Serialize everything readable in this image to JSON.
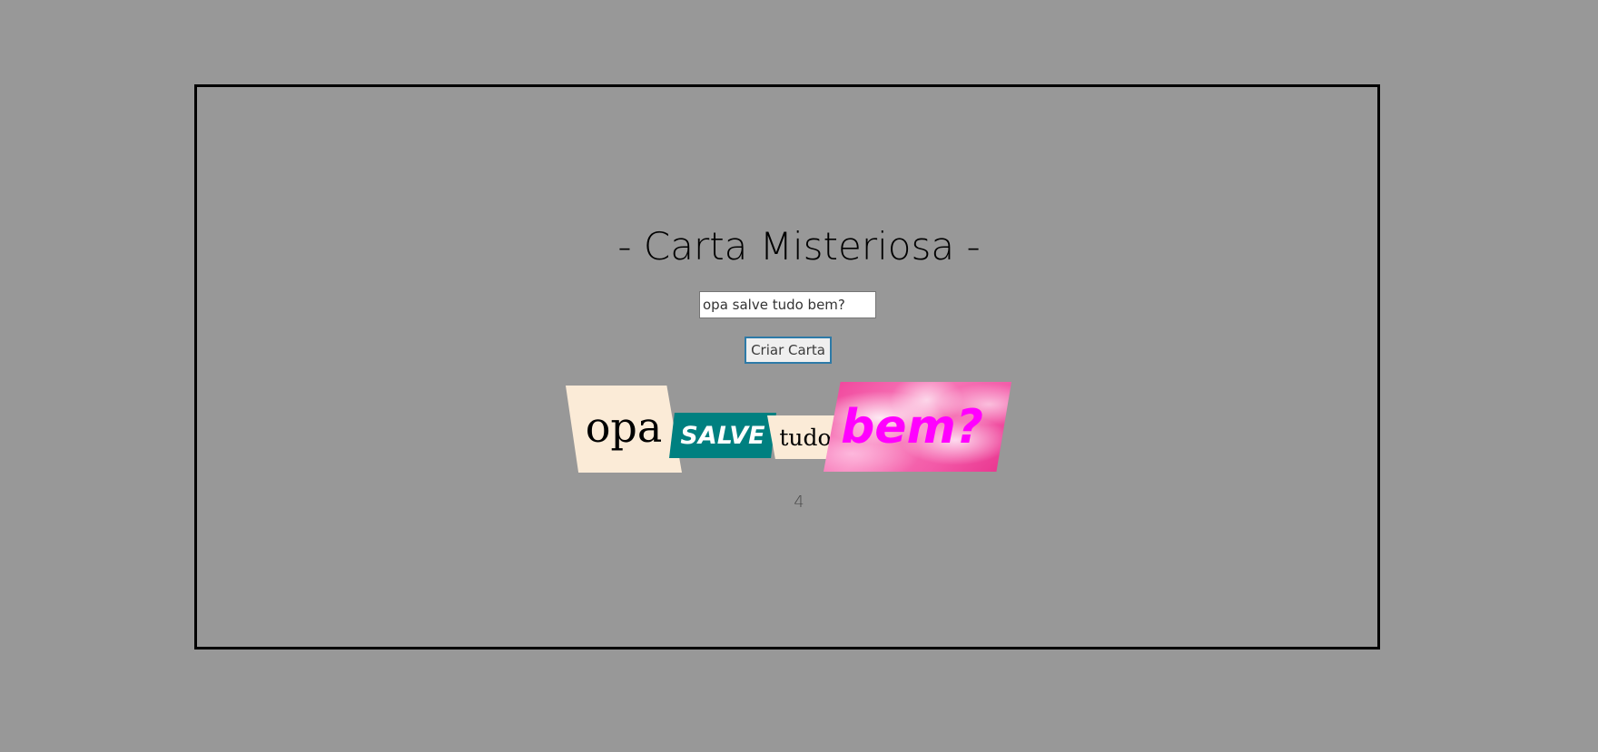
{
  "page": {
    "title": "- Carta Misteriosa -",
    "background_color": "#989898"
  },
  "input": {
    "value": "opa salve tudo bem?"
  },
  "button": {
    "label": "Criar Carta"
  },
  "letter": {
    "words": [
      {
        "text": "opa",
        "style": "newspaper-serif-cream"
      },
      {
        "text": "SALVE",
        "style": "bold-italic-white-on-teal",
        "background": "#008080"
      },
      {
        "text": "tudo",
        "style": "serif-cream"
      },
      {
        "text": "bem?",
        "style": "bold-italic-magenta-on-pink-sky",
        "color": "#ff00ff"
      }
    ]
  },
  "word_count": "4"
}
